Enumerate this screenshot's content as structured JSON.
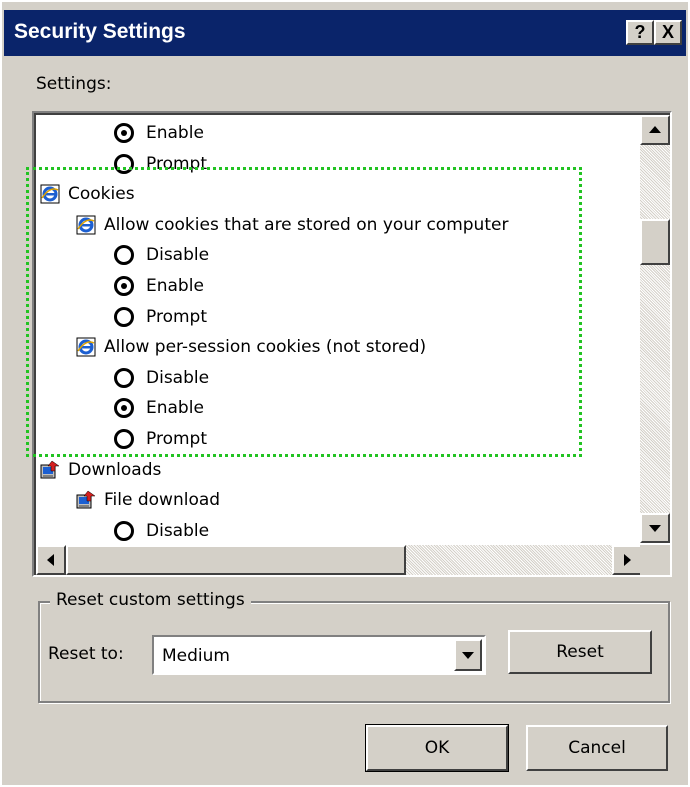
{
  "window": {
    "title": "Security Settings",
    "help_label": "?",
    "close_label": "X"
  },
  "settings_label": "Settings:",
  "list_items": [
    {
      "kind": "radio",
      "label": "Enable",
      "selected": true,
      "indent": 2
    },
    {
      "kind": "radio",
      "label": "Prompt",
      "selected": false,
      "indent": 2
    },
    {
      "kind": "category",
      "label": "Cookies",
      "icon": "ie-icon",
      "indent": 0
    },
    {
      "kind": "setting",
      "label": "Allow cookies that are stored on your computer",
      "icon": "ie-icon",
      "indent": 1
    },
    {
      "kind": "radio",
      "label": "Disable",
      "selected": false,
      "indent": 2
    },
    {
      "kind": "radio",
      "label": "Enable",
      "selected": true,
      "indent": 2
    },
    {
      "kind": "radio",
      "label": "Prompt",
      "selected": false,
      "indent": 2
    },
    {
      "kind": "setting",
      "label": "Allow per-session cookies (not stored)",
      "icon": "ie-icon",
      "indent": 1
    },
    {
      "kind": "radio",
      "label": "Disable",
      "selected": false,
      "indent": 2
    },
    {
      "kind": "radio",
      "label": "Enable",
      "selected": true,
      "indent": 2
    },
    {
      "kind": "radio",
      "label": "Prompt",
      "selected": false,
      "indent": 2
    },
    {
      "kind": "category",
      "label": "Downloads",
      "icon": "download-icon",
      "indent": 0
    },
    {
      "kind": "setting",
      "label": "File download",
      "icon": "download-icon",
      "indent": 1
    },
    {
      "kind": "radio",
      "label": "Disable",
      "selected": false,
      "indent": 2
    }
  ],
  "reset_group": {
    "title": "Reset custom settings",
    "reset_to_label": "Reset to:",
    "reset_to_value": "Medium",
    "reset_button": "Reset"
  },
  "buttons": {
    "ok": "OK",
    "cancel": "Cancel"
  },
  "colors": {
    "titlebar": "#0a246a",
    "face": "#d4d0c8",
    "focus_highlight": "#22c322"
  }
}
